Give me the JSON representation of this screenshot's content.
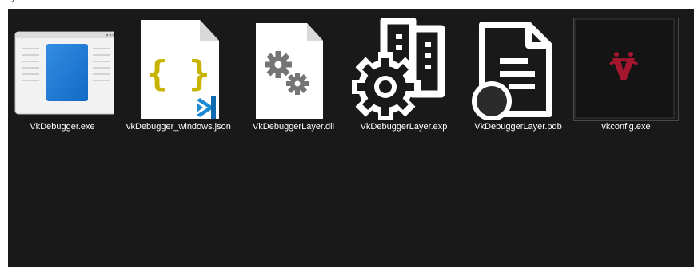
{
  "address_bar": {
    "text": "y"
  },
  "files": [
    {
      "name": "VkDebugger.exe",
      "icon": "app-window-icon"
    },
    {
      "name": "vkDebugger_windows.json",
      "icon": "json-file-icon"
    },
    {
      "name": "VkDebuggerLayer.dll",
      "icon": "dll-gears-icon"
    },
    {
      "name": "VkDebuggerLayer.exp",
      "icon": "exp-gear-icon"
    },
    {
      "name": "VkDebuggerLayer.pdb",
      "icon": "pdb-file-icon"
    },
    {
      "name": "vkconfig.exe",
      "icon": "vulkan-logo-icon"
    }
  ],
  "colors": {
    "background": "#191919",
    "text": "#ffffff",
    "window_blue": "#1578d6",
    "json_yellow": "#c8b400",
    "vscode_blue": "#1f8ad2",
    "vulkan_red": "#a4162e"
  }
}
